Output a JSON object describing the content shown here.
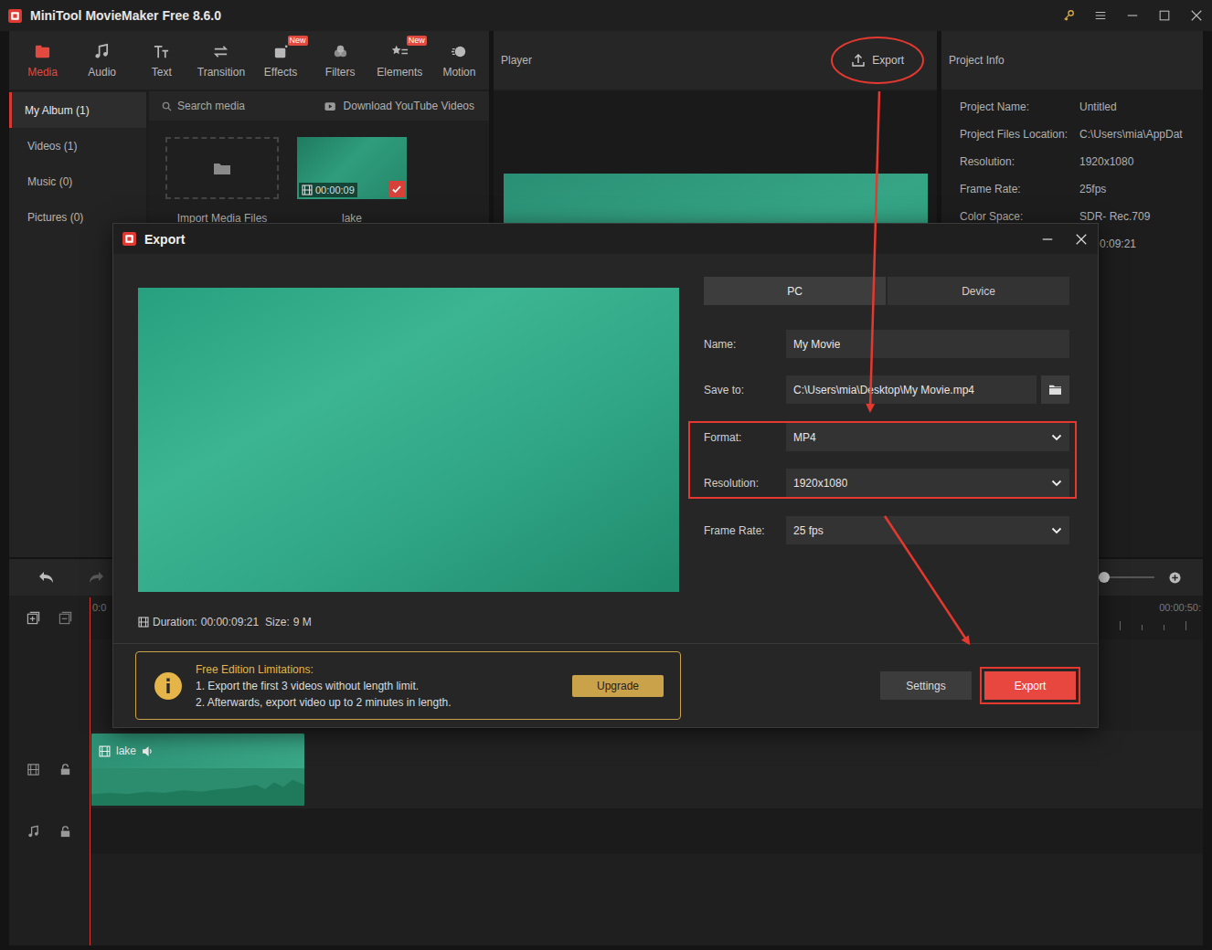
{
  "window": {
    "title": "MiniTool MovieMaker Free 8.6.0"
  },
  "toolbar": [
    {
      "label": "Media",
      "selected": true,
      "badge": ""
    },
    {
      "label": "Audio",
      "selected": false,
      "badge": ""
    },
    {
      "label": "Text",
      "selected": false,
      "badge": ""
    },
    {
      "label": "Transition",
      "selected": false,
      "badge": ""
    },
    {
      "label": "Effects",
      "selected": false,
      "badge": "New"
    },
    {
      "label": "Filters",
      "selected": false,
      "badge": ""
    },
    {
      "label": "Elements",
      "selected": false,
      "badge": "New"
    },
    {
      "label": "Motion",
      "selected": false,
      "badge": ""
    }
  ],
  "album": [
    {
      "label": "My Album (1)",
      "selected": true
    },
    {
      "label": "Videos (1)",
      "selected": false
    },
    {
      "label": "Music (0)",
      "selected": false
    },
    {
      "label": "Pictures (0)",
      "selected": false
    }
  ],
  "media": {
    "search_placeholder": "Search media",
    "youtube": "Download YouTube Videos",
    "import_label": "Import Media Files",
    "clips": [
      {
        "name": "lake",
        "duration": "00:00:09",
        "selected": true
      }
    ]
  },
  "player": {
    "title": "Player",
    "export": {
      "label": "Export",
      "highlighted": true
    }
  },
  "project_info": {
    "title": "Project Info",
    "rows": [
      {
        "label": "Project Name:",
        "value": "Untitled"
      },
      {
        "label": "Project Files Location:",
        "value": "C:\\Users\\mia\\AppDat"
      },
      {
        "label": "Resolution:",
        "value": "1920x1080"
      },
      {
        "label": "Frame Rate:",
        "value": "25fps"
      },
      {
        "label": "Color Space:",
        "value": "SDR- Rec.709"
      },
      {
        "label": "",
        "value": "0:09:21"
      }
    ]
  },
  "timeline": {
    "ruler": [
      "0:0",
      "00:00:50:"
    ],
    "zoom": {
      "level": 0.63
    },
    "redo_disabled": true,
    "clips": [
      {
        "name": "lake"
      }
    ]
  },
  "dialog": {
    "title": "Export",
    "tabs": [
      {
        "label": "PC",
        "selected": true
      },
      {
        "label": "Device",
        "selected": false
      }
    ],
    "fields": [
      {
        "label": "Name:",
        "value": "My Movie",
        "kind": "text",
        "highlighted": false
      },
      {
        "label": "Save to:",
        "value": "C:\\Users\\mia\\Desktop\\My Movie.mp4",
        "kind": "path",
        "highlighted": false
      },
      {
        "label": "Format:",
        "value": "MP4",
        "kind": "select",
        "highlighted": true
      },
      {
        "label": "Resolution:",
        "value": "1920x1080",
        "kind": "select",
        "highlighted": true
      },
      {
        "label": "Frame Rate:",
        "value": "25 fps",
        "kind": "select",
        "highlighted": false
      }
    ],
    "duration_label": "Duration:",
    "duration": "00:00:09:21",
    "size_label": "Size:",
    "size": "9 M",
    "notice": {
      "title": "Free Edition Limitations:",
      "lines": [
        "1. Export the first 3 videos without length limit.",
        "2. Afterwards, export video up to 2 minutes in length."
      ],
      "button": "Upgrade"
    },
    "buttons": [
      {
        "label": "Settings",
        "primary": false,
        "highlighted": false
      },
      {
        "label": "Export",
        "primary": true,
        "highlighted": true
      }
    ]
  }
}
